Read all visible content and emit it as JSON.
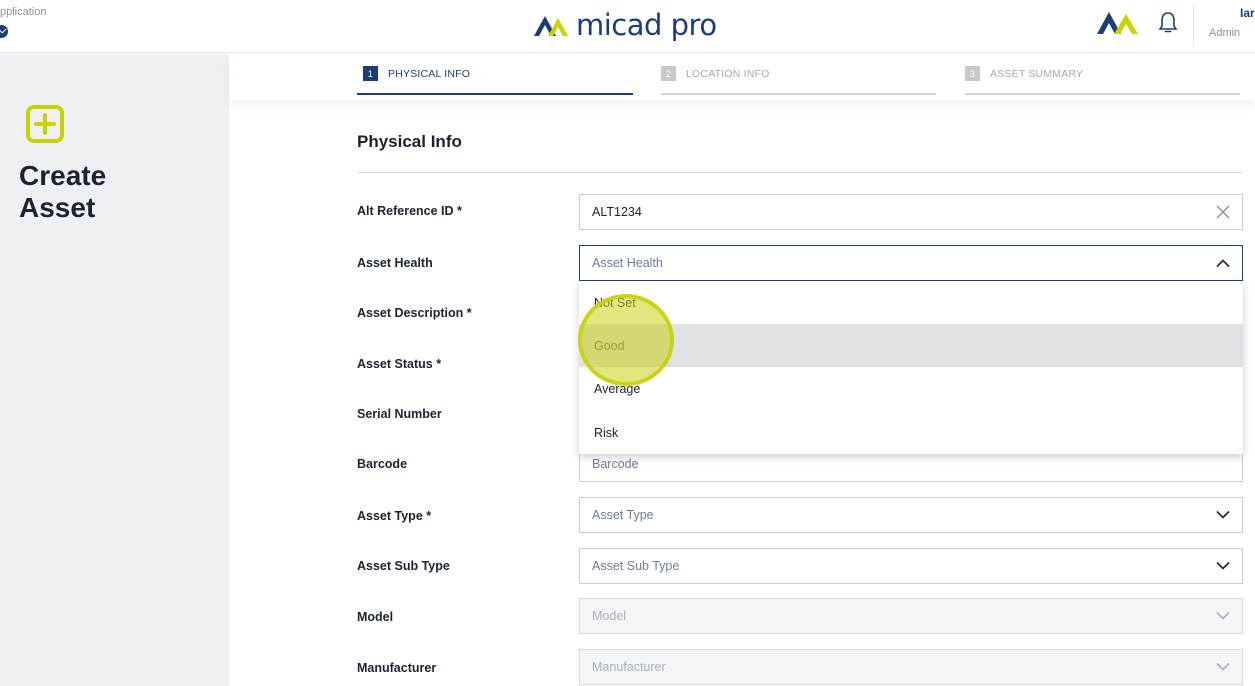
{
  "header": {
    "app_switcher_label": "pplication",
    "logo_text": "micad pro",
    "user_name": "Iar",
    "user_role": "Admin"
  },
  "sidebar": {
    "title_line1": "Create",
    "title_line2": "Asset"
  },
  "steps": [
    {
      "number": "1",
      "label": "PHYSICAL INFO",
      "active": true
    },
    {
      "number": "2",
      "label": "LOCATION INFO",
      "active": false
    },
    {
      "number": "3",
      "label": "ASSET SUMMARY",
      "active": false
    }
  ],
  "form": {
    "section_title": "Physical Info",
    "fields": {
      "alt_reference_id": {
        "label": "Alt Reference ID *",
        "value": "ALT1234"
      },
      "asset_health": {
        "label": "Asset Health",
        "placeholder": "Asset Health"
      },
      "asset_description": {
        "label": "Asset Description *"
      },
      "asset_status": {
        "label": "Asset Status *"
      },
      "serial_number": {
        "label": "Serial Number"
      },
      "barcode": {
        "label": "Barcode",
        "placeholder": "Barcode"
      },
      "asset_type": {
        "label": "Asset Type *",
        "placeholder": "Asset Type"
      },
      "asset_sub_type": {
        "label": "Asset Sub Type",
        "placeholder": "Asset Sub Type"
      },
      "model": {
        "label": "Model",
        "placeholder": "Model"
      },
      "manufacturer": {
        "label": "Manufacturer",
        "placeholder": "Manufacturer"
      }
    }
  },
  "asset_health_options": [
    "Not Set",
    "Good",
    "Average",
    "Risk"
  ],
  "colors": {
    "brand_navy": "#1b3d7a",
    "brand_lime": "#c8d400",
    "sidebar_bg": "#eef0f3"
  },
  "icons": [
    "check-circle-icon",
    "micad-logo-icon",
    "brand-mark-icon",
    "bell-icon",
    "add-box-icon",
    "clear-icon",
    "chevron-up-icon",
    "chevron-down-icon"
  ]
}
